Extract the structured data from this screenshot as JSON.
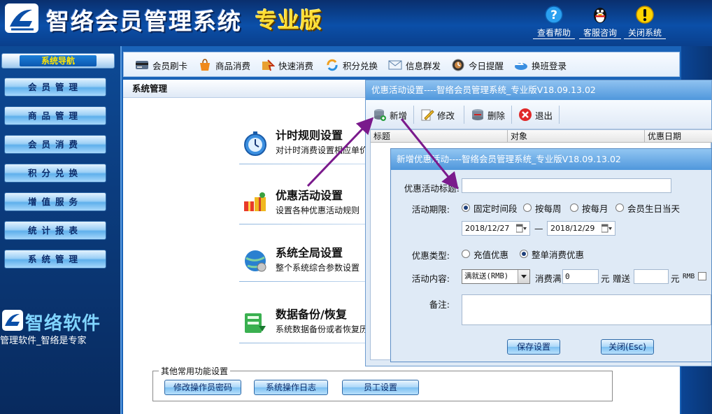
{
  "header": {
    "app_title": "智络会员管理系统",
    "app_edition": "专业版",
    "help_label": "查看帮助",
    "support_label": "客服咨询",
    "close_label": "关闭系统",
    "brand_color": "#0b4fa8"
  },
  "sidebar": {
    "heading": "系统导航",
    "items": [
      {
        "label": "会员管理"
      },
      {
        "label": "商品管理"
      },
      {
        "label": "会员消费"
      },
      {
        "label": "积分兑换"
      },
      {
        "label": "增值服务"
      },
      {
        "label": "统计报表"
      },
      {
        "label": "系统管理"
      }
    ],
    "brand_name": "智络软件",
    "brand_slogan": "管理软件_智络是专家"
  },
  "toolbar": {
    "items": [
      {
        "label": "会员刷卡",
        "icon": "card-reader-icon"
      },
      {
        "label": "商品消费",
        "icon": "shopping-bag-icon"
      },
      {
        "label": "快速消费",
        "icon": "fast-consume-icon"
      },
      {
        "label": "积分兑换",
        "icon": "exchange-icon"
      },
      {
        "label": "信息群发",
        "icon": "mail-icon"
      },
      {
        "label": "今日提醒",
        "icon": "reminder-icon"
      },
      {
        "label": "换班登录",
        "icon": "shift-login-icon"
      }
    ]
  },
  "content": {
    "title": "系统管理",
    "settings": [
      {
        "title": "计时规则设置",
        "desc": "对计时消费设置相应单价"
      },
      {
        "title": "优惠活动设置",
        "desc": "设置各种优惠活动规则"
      },
      {
        "title": "系统全局设置",
        "desc": "整个系统综合参数设置"
      },
      {
        "title": "数据备份/恢复",
        "desc": "系统数据备份或者恢复历史"
      }
    ],
    "other_group_label": "其他常用功能设置",
    "other_buttons": [
      {
        "label": "修改操作员密码"
      },
      {
        "label": "系统操作日志"
      },
      {
        "label": "员工设置"
      }
    ]
  },
  "promo_dialog": {
    "title": "优惠活动设置----智络会员管理系统_专业版V18.09.13.02",
    "tools": {
      "new": "新增",
      "edit": "修改",
      "delete": "删除",
      "exit": "退出"
    },
    "columns": [
      "标题",
      "对象",
      "优惠日期"
    ]
  },
  "new_promo_dialog": {
    "title": "新增优惠活动----智络会员管理系统_专业版V18.09.13.02",
    "title_label": "优惠活动标题:",
    "title_value": "",
    "period_label": "活动期限:",
    "period_options": [
      {
        "label": "固定时间段",
        "selected": true
      },
      {
        "label": "按每周",
        "selected": false
      },
      {
        "label": "按每月",
        "selected": false
      },
      {
        "label": "会员生日当天",
        "selected": false
      }
    ],
    "start_date": "2018/12/27",
    "date_separator": "—",
    "end_date": "2018/12/29",
    "type_label": "优惠类型:",
    "type_options": [
      {
        "label": "充值优惠",
        "selected": false
      },
      {
        "label": "整单消费优惠",
        "selected": true
      }
    ],
    "content_label": "活动内容:",
    "content_select": "满就送(RMB)",
    "spend_label": "消费满",
    "spend_value": "0",
    "unit1": "元",
    "gift_label": "赠送",
    "gift_value": "",
    "unit2": "元",
    "rmb_label": "RMB",
    "remark_label": "备注:",
    "remark_value": "",
    "save_button": "保存设置",
    "close_button": "关闭(Esc)"
  }
}
